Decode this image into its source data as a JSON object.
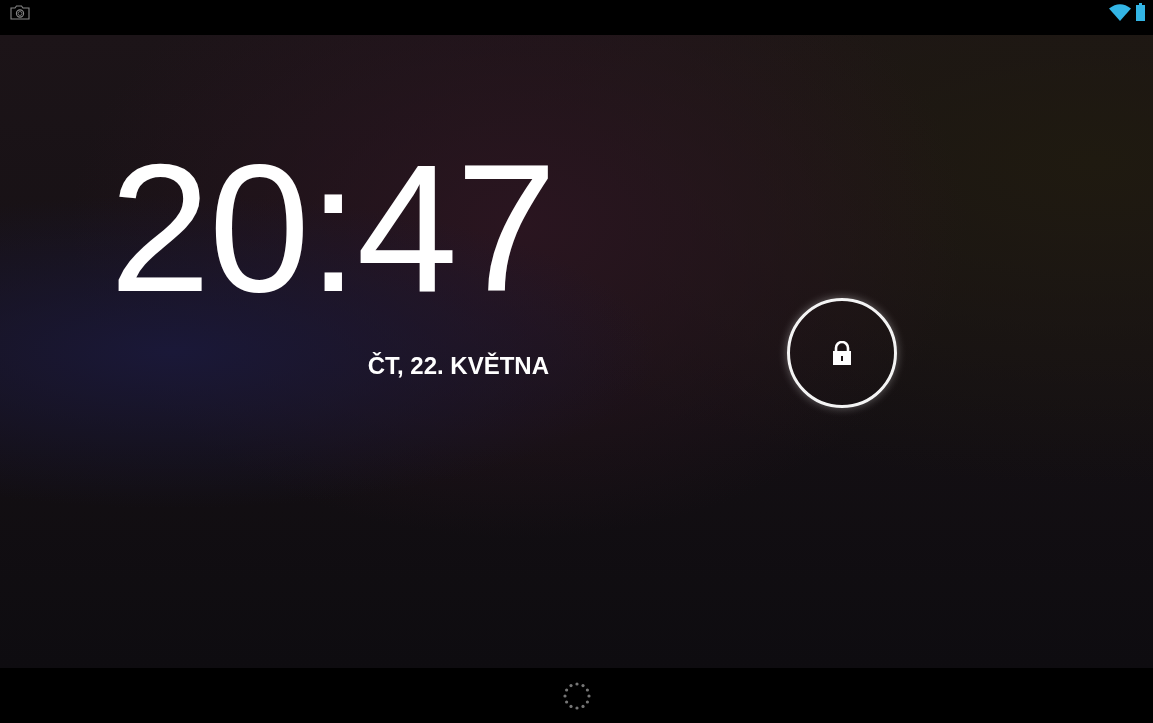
{
  "lockscreen": {
    "time": "20:47",
    "date": "ČT, 22. KVĚTNA"
  }
}
